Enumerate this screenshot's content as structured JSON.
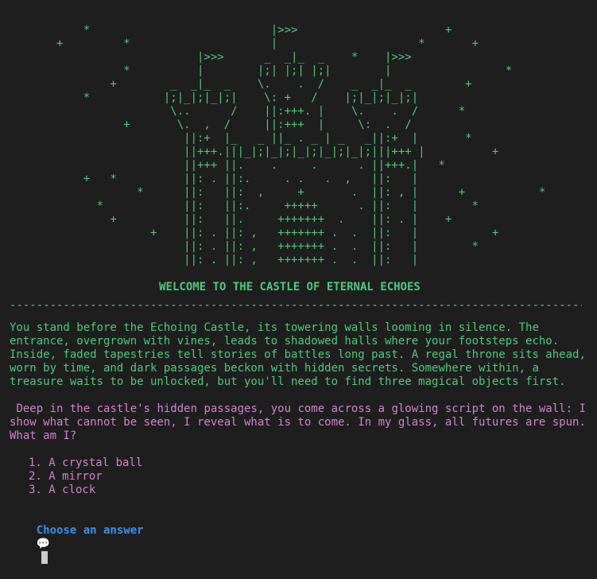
{
  "theme": {
    "background": "#1e1e1e",
    "art_color": "#4ec97b",
    "riddle_color": "#d67fd2",
    "prompt_color": "#3b8eea"
  },
  "ascii_art": "           *                           |>>>                      +\n       +         *                     |                     *       +\n                            |>>>      _  _|_  _    *    |>>>\n                 *          |        |;| |;| |;|        |                 *\n               +        _  _|_  _    \\.    .  /    _  _|_  _        +\n           *           |;|_|;|_|;|    \\: +   /    |;|_|;|_|;|\n                        \\..      /    ||:+++. |    \\.    .  /      *\n                 +       \\.  ,  /     ||:+++  |     \\:  .  /\n                          ||:+  |_   _ ||_ . _ | _   _||:+  |       *\n                          ||+++.|||_|;|_|;|_|;|_|;|_|;|||+++ |          +\n                          ||+++ ||.    .     .      . ||+++.|   *\n           +   *          ||: . ||:.     . .   .  ,   ||:   |\n                   *      ||:   ||:  ,     +       .  ||: , |      +           *\n             *            ||:   ||:.     +++++      . ||:   |        *\n               +          ||:   ||.     +++++++  .    ||: . |    +\n                     +    ||: . ||: ,   +++++++ .  .  ||:   |           +\n                          ||: . ||: ,   +++++++ .  .  ||:   |        *\n                          ||: . ||: ,   +++++++ .  .  ||:   |",
  "title": "WELCOME TO THE CASTLE OF ETERNAL ECHOES",
  "rule": "------------------------------------------------------------------------------------------",
  "intro": "You stand before the Echoing Castle, its towering walls looming in silence. The entrance, overgrown with vines, leads to shadowed halls where your footsteps echo. Inside, faded tapestries tell stories of battles long past. A regal throne sits ahead, worn by time, and dark passages beckon with hidden secrets. Somewhere within, a treasure waits to be unlocked, but you'll need to find three magical objects first.",
  "riddle": " Deep in the castle's hidden passages, you come across a glowing script on the wall: I show what cannot be seen, I reveal what is to come. In my glass, all futures are spun. What am I?",
  "options": [
    "1. A crystal ball",
    "2. A mirror",
    "3. A clock"
  ],
  "prompt": {
    "label": "Choose an answer",
    "icon": "speech-bubble-icon",
    "glyph": "💬"
  }
}
